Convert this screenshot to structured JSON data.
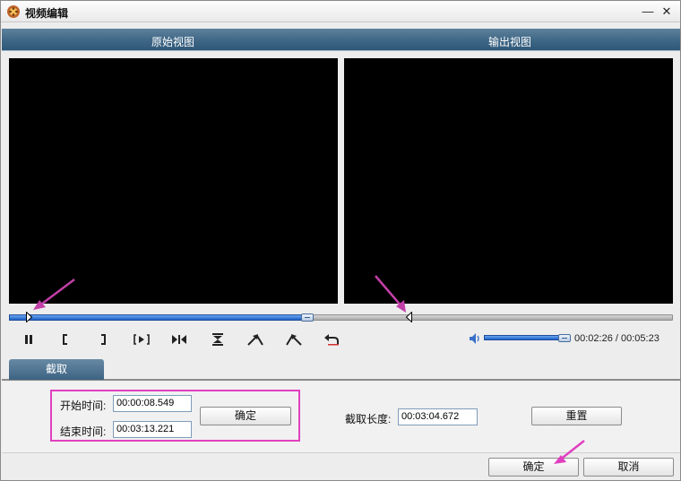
{
  "window": {
    "title": "视频编辑",
    "minimize_glyph": "—",
    "close_glyph": "✕"
  },
  "views": {
    "original_label": "原始视图",
    "output_label": "输出视图"
  },
  "timeline": {
    "progress_fraction": 0.45
  },
  "controls": {
    "icons": [
      "pause-icon",
      "mark-in-icon",
      "mark-out-icon",
      "play-selection-icon",
      "jump-icon",
      "trim-icon",
      "rotate-left-icon",
      "rotate-right-icon",
      "undo-icon"
    ],
    "volume_fraction": 1.0,
    "time_display": "00:02:26 / 00:05:23"
  },
  "tabs": [
    {
      "label": "截取"
    }
  ],
  "trim": {
    "start_label": "开始时间:",
    "start_value": "00:00:08.549",
    "end_label": "结束时间:",
    "end_value": "00:03:13.221",
    "confirm_label": "确定",
    "length_label": "截取长度:",
    "length_value": "00:03:04.672",
    "reset_label": "重置"
  },
  "footer": {
    "ok_label": "确定",
    "cancel_label": "取消"
  },
  "colors": {
    "accent_blue": "#1d5fc4",
    "header_blue": "#3e6685",
    "highlight_magenta": "#e040c0"
  }
}
